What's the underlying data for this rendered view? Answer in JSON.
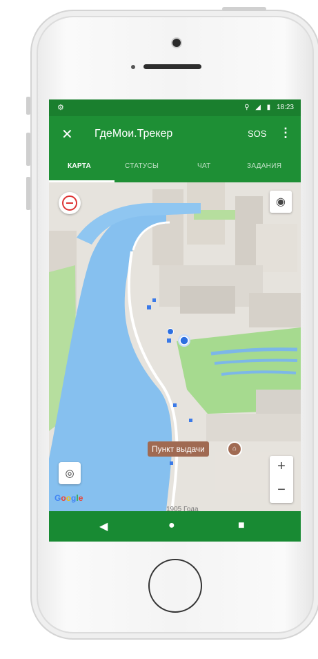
{
  "status_bar": {
    "app_icon": "android-icon",
    "time": "18:23",
    "location_glyph": "⚲",
    "signal_glyph": "◢",
    "battery_glyph": "▮"
  },
  "app_bar": {
    "title": "ГдеМои.Трекер",
    "sos_label": "SOS",
    "more_glyph": "⋮",
    "app_glyph": "✕"
  },
  "tabs": [
    {
      "label": "КАРТА",
      "active": true
    },
    {
      "label": "СТАТУСЫ",
      "active": false
    },
    {
      "label": "ЧАТ",
      "active": false
    },
    {
      "label": "ЗАДАНИЯ",
      "active": false
    }
  ],
  "map": {
    "place_label": "Пункт выдачи",
    "place_icon_glyph": "⌂",
    "zoom_in": "+",
    "zoom_out": "−",
    "locate_glyph": "◉",
    "layers_glyph": "◎",
    "street_label": "1905 Года",
    "google_logo": {
      "g1": "G",
      "g2": "o",
      "g3": "o",
      "g4": "g",
      "g5": "l",
      "g6": "e"
    }
  },
  "nav_bar": {
    "back_glyph": "◀",
    "home_glyph": "●",
    "recents_glyph": "■"
  },
  "colors": {
    "primary": "#1e8f35",
    "status": "#1a7f2e",
    "river": "#86c0ef",
    "park": "#9fd88d",
    "marker": "#3b7ae8",
    "place": "#a06a52"
  }
}
